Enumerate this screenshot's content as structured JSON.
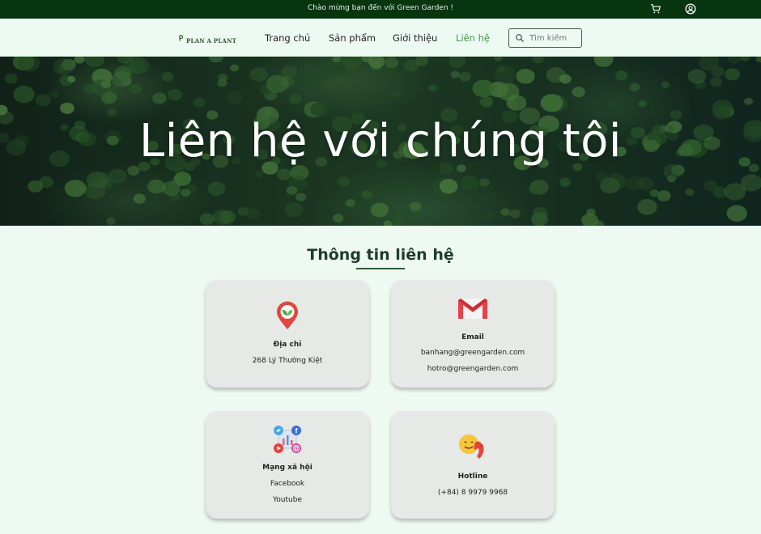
{
  "topbar": {
    "welcome": "Chào mừng bạn đến với Green Garden !",
    "cart_icon": "cart-icon",
    "account_icon": "account-icon"
  },
  "nav": {
    "logo_text": "PLAN A PLANT",
    "links": [
      "Trang chủ",
      "Sản phẩm",
      "Giới thiệu",
      "Liên hệ"
    ],
    "active_link": "Liên hệ",
    "search_placeholder": "Tìm kiếm",
    "active_color": "#3f9a45"
  },
  "hero": {
    "title": "Liên hệ với chúng tôi"
  },
  "section": {
    "title": "Thông tin liên hệ"
  },
  "cards": {
    "address": {
      "icon": "location-pin-icon",
      "title": "Địa chỉ",
      "lines": [
        "268 Lý Thường Kiệt"
      ]
    },
    "email": {
      "icon": "mail-icon",
      "title": "Email",
      "lines": [
        "banhang@greengarden.com",
        "hotro@greengarden.com"
      ]
    },
    "social": {
      "icon": "social-network-icon",
      "title": "Mạng xã hội",
      "lines": [
        "Facebook",
        "Youtube"
      ]
    },
    "hotline": {
      "icon": "phone-icon",
      "title": "Hotline",
      "lines": [
        "(+84) 8 9979 9968"
      ]
    }
  },
  "colors": {
    "topbar_bg": "#06350f",
    "page_bg": "#eefaf1",
    "card_bg": "#e7e9e6",
    "section_title": "#1f3d2a"
  }
}
